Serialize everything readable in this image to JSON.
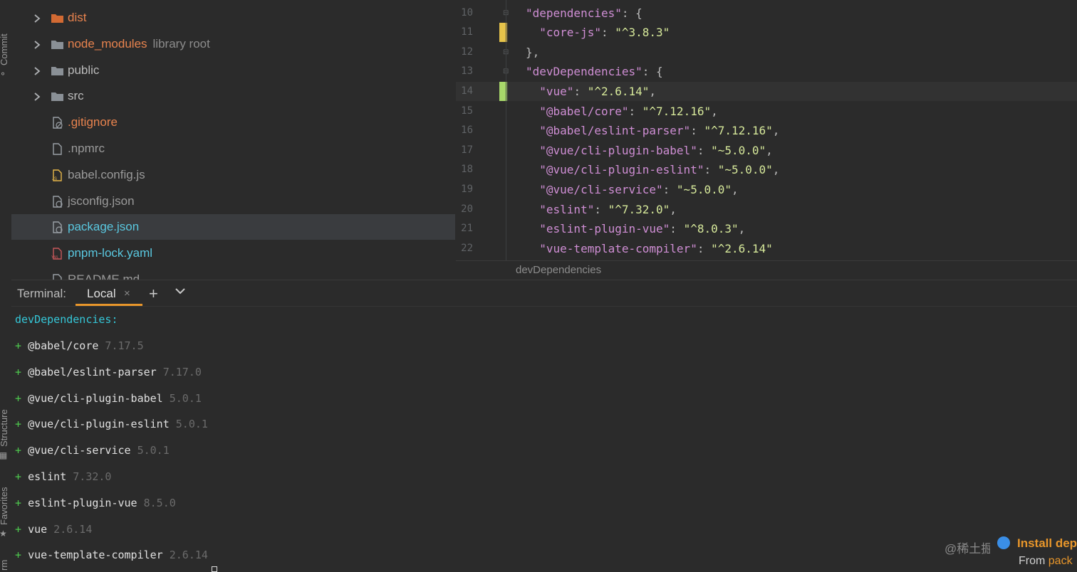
{
  "tool_strip": {
    "commit": "Commit",
    "structure": "Structure",
    "favorites": "Favorites",
    "bottom": "rm"
  },
  "project": {
    "items": [
      {
        "name": "dist",
        "kind": "folder-excluded",
        "expandable": true,
        "color": "#e8834e"
      },
      {
        "name": "node_modules",
        "hint": "library root",
        "kind": "folder",
        "expandable": true,
        "color": "#e8834e"
      },
      {
        "name": "public",
        "kind": "folder",
        "expandable": true,
        "color": "#bbbbbb"
      },
      {
        "name": "src",
        "kind": "folder",
        "expandable": true,
        "color": "#bbbbbb"
      },
      {
        "name": ".gitignore",
        "kind": "file-ignore",
        "color": "#e8834e"
      },
      {
        "name": ".npmrc",
        "kind": "file",
        "color": "#9a9a9a"
      },
      {
        "name": "babel.config.js",
        "kind": "file-js",
        "color": "#9a9a9a"
      },
      {
        "name": "jsconfig.json",
        "kind": "file-json",
        "color": "#9a9a9a"
      },
      {
        "name": "package.json",
        "kind": "file-json",
        "color": "#5ac8e0",
        "selected": true
      },
      {
        "name": "pnpm-lock.yaml",
        "kind": "file-yaml",
        "color": "#5ac8e0"
      },
      {
        "name": "README.md",
        "kind": "file",
        "color": "#9a9a9a"
      }
    ]
  },
  "editor": {
    "current_line": 14,
    "lines": [
      {
        "num": "10",
        "indent": "",
        "key": "\"dependencies\"",
        "sep": ": ",
        "val": "",
        "tail": "{",
        "fold": true
      },
      {
        "num": "11",
        "indent": "  ",
        "key": "\"core-js\"",
        "sep": ": ",
        "val": "\"^3.8.3\"",
        "tail": "",
        "marker": "#e6c34a"
      },
      {
        "num": "12",
        "indent": "",
        "key": "",
        "sep": "",
        "val": "",
        "tail": "},",
        "fold": true
      },
      {
        "num": "13",
        "indent": "",
        "key": "\"devDependencies\"",
        "sep": ": ",
        "val": "",
        "tail": "{",
        "fold": true
      },
      {
        "num": "14",
        "indent": "  ",
        "key": "\"vue\"",
        "sep": ": ",
        "val": "\"^2.6.14\"",
        "tail": ",",
        "marker": "#a8d86a"
      },
      {
        "num": "15",
        "indent": "  ",
        "key": "\"@babel/core\"",
        "sep": ": ",
        "val": "\"^7.12.16\"",
        "tail": ","
      },
      {
        "num": "16",
        "indent": "  ",
        "key": "\"@babel/eslint-parser\"",
        "sep": ": ",
        "val": "\"^7.12.16\"",
        "tail": ","
      },
      {
        "num": "17",
        "indent": "  ",
        "key": "\"@vue/cli-plugin-babel\"",
        "sep": ": ",
        "val": "\"~5.0.0\"",
        "tail": ","
      },
      {
        "num": "18",
        "indent": "  ",
        "key": "\"@vue/cli-plugin-eslint\"",
        "sep": ": ",
        "val": "\"~5.0.0\"",
        "tail": ","
      },
      {
        "num": "19",
        "indent": "  ",
        "key": "\"@vue/cli-service\"",
        "sep": ": ",
        "val": "\"~5.0.0\"",
        "tail": ","
      },
      {
        "num": "20",
        "indent": "  ",
        "key": "\"eslint\"",
        "sep": ": ",
        "val": "\"^7.32.0\"",
        "tail": ","
      },
      {
        "num": "21",
        "indent": "  ",
        "key": "\"eslint-plugin-vue\"",
        "sep": ": ",
        "val": "\"^8.0.3\"",
        "tail": ","
      },
      {
        "num": "22",
        "indent": "  ",
        "key": "\"vue-template-compiler\"",
        "sep": ": ",
        "val": "\"^2.6.14\"",
        "tail": ""
      }
    ],
    "breadcrumb": "devDependencies"
  },
  "terminal": {
    "title": "Terminal:",
    "tab_label": "Local",
    "close_glyph": "×",
    "add_glyph": "+",
    "heading": "devDependencies:",
    "packages": [
      {
        "name": "@babel/core",
        "version": "7.17.5"
      },
      {
        "name": "@babel/eslint-parser",
        "version": "7.17.0"
      },
      {
        "name": "@vue/cli-plugin-babel",
        "version": "5.0.1"
      },
      {
        "name": "@vue/cli-plugin-eslint",
        "version": "5.0.1"
      },
      {
        "name": "@vue/cli-service",
        "version": "5.0.1"
      },
      {
        "name": "eslint",
        "version": "7.32.0"
      },
      {
        "name": "eslint-plugin-vue",
        "version": "8.5.0"
      },
      {
        "name": "vue",
        "version": "2.6.14"
      },
      {
        "name": "vue-template-compiler",
        "version": "2.6.14"
      }
    ]
  },
  "notification": {
    "title": "Install dep",
    "body_prefix": "From ",
    "body_link": "pack"
  },
  "watermark": "@稀土掘金技术社区"
}
